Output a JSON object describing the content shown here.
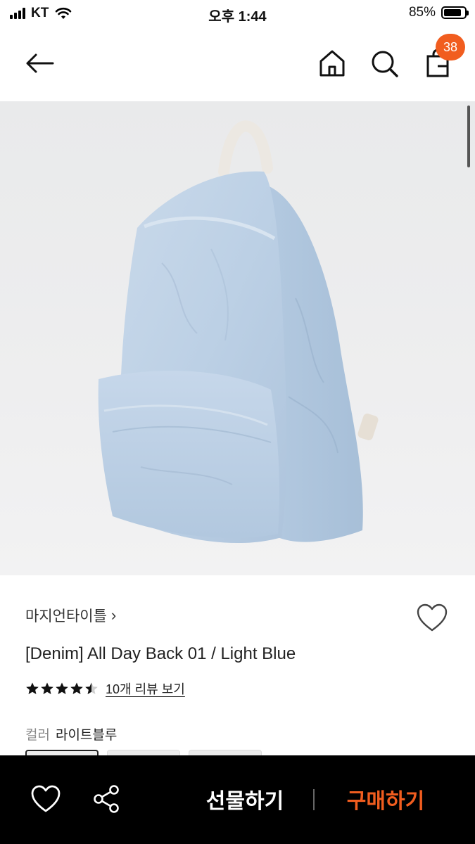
{
  "status_bar": {
    "carrier": "KT",
    "time": "오후 1:44",
    "battery_percent": "85%",
    "battery_level": 0.85
  },
  "nav": {
    "back_icon": "arrow-left-icon",
    "home_icon": "home-icon",
    "search_icon": "search-icon",
    "cart_icon": "shopping-bag-icon",
    "cart_badge": "38",
    "badge_color": "#f15d1f"
  },
  "product": {
    "image": "light-blue-denim-backpack",
    "brand": "마지언타이틀",
    "title": "[Denim] All Day Back 01 / Light Blue",
    "rating": 4.5,
    "review_link": "10개 리뷰 보기",
    "color_label": "컬러",
    "color_value": "라이트블루"
  },
  "bottom_bar": {
    "wish_icon": "heart-icon",
    "share_icon": "share-icon",
    "gift_label": "선물하기",
    "buy_label": "구매하기",
    "accent_color": "#f15d1f"
  }
}
